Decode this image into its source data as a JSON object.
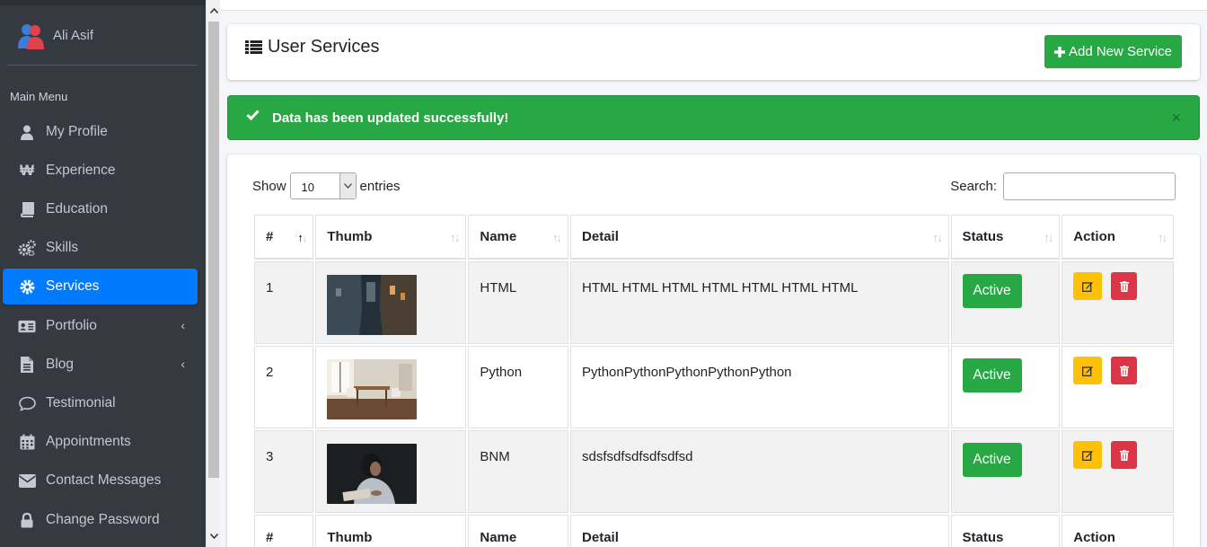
{
  "sidebar": {
    "user_name": "Ali Asif",
    "menu_header": "Main Menu",
    "items": [
      {
        "label": "My Profile",
        "icon": "user-icon"
      },
      {
        "label": "Experience",
        "icon": "won-sign-icon"
      },
      {
        "label": "Education",
        "icon": "book-icon"
      },
      {
        "label": "Skills",
        "icon": "cogs-icon"
      },
      {
        "label": "Services",
        "icon": "gear-icon",
        "active": true
      },
      {
        "label": "Portfolio",
        "icon": "id-card-icon",
        "expandable": true
      },
      {
        "label": "Blog",
        "icon": "file-icon",
        "expandable": true
      },
      {
        "label": "Testimonial",
        "icon": "comment-icon"
      },
      {
        "label": "Appointments",
        "icon": "calendar-icon"
      },
      {
        "label": "Contact Messages",
        "icon": "envelope-icon"
      },
      {
        "label": "Change Password",
        "icon": "lock-icon"
      }
    ]
  },
  "header": {
    "title": "User Services",
    "add_button": "Add New Service"
  },
  "alert": {
    "message": "Data has been updated successfully!",
    "close": "×"
  },
  "table": {
    "show_label": "Show",
    "entries_value": "10",
    "entries_label": "entries",
    "search_label": "Search:",
    "columns": [
      "#",
      "Thumb",
      "Name",
      "Detail",
      "Status",
      "Action"
    ],
    "rows": [
      {
        "num": "1",
        "name": "HTML",
        "detail": "HTML HTML HTML HTML HTML HTML HTML",
        "status": "Active"
      },
      {
        "num": "2",
        "name": "Python",
        "detail": "PythonPythonPythonPythonPython",
        "status": "Active"
      },
      {
        "num": "3",
        "name": "BNM",
        "detail": "sdsfsdfsdfsdfsdfsd",
        "status": "Active"
      }
    ]
  },
  "colors": {
    "sidebar_bg": "#343a40",
    "active": "#007bff",
    "success": "#28a745",
    "warning": "#ffc107",
    "danger": "#dc3545"
  }
}
